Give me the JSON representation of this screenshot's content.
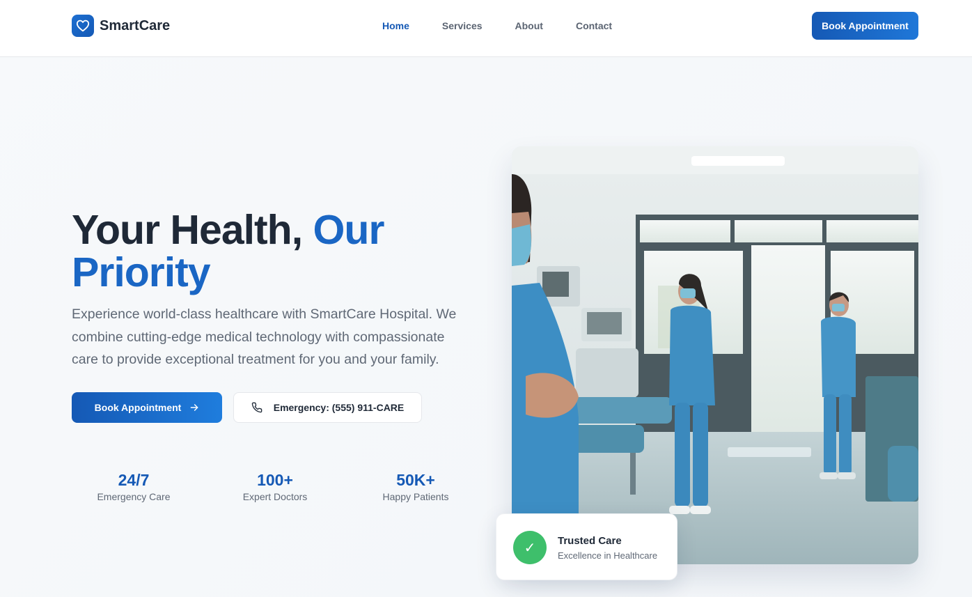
{
  "brand": {
    "name": "SmartCare",
    "logo_icon": "heart-icon"
  },
  "nav": {
    "items": [
      {
        "label": "Home",
        "active": true
      },
      {
        "label": "Services",
        "active": false
      },
      {
        "label": "About",
        "active": false
      },
      {
        "label": "Contact",
        "active": false
      }
    ],
    "cta_label": "Book Appointment"
  },
  "hero": {
    "title_part1": "Your Health,",
    "title_accent": "Our Priority",
    "description": "Experience world-class healthcare with SmartCare Hospital. We combine cutting-edge medical technology with compassionate care to provide exceptional treatment for you and your family.",
    "primary_button": "Book Appointment",
    "secondary_button": "Emergency: (555) 911-CARE"
  },
  "stats": [
    {
      "value": "24/7",
      "label": "Emergency Care"
    },
    {
      "value": "100+",
      "label": "Expert Doctors"
    },
    {
      "value": "50K+",
      "label": "Happy Patients"
    }
  ],
  "trust_card": {
    "title": "Trusted Care",
    "subtitle": "Excellence in Healthcare",
    "icon": "check-icon"
  },
  "colors": {
    "primary": "#1559b5",
    "accent": "#1a66c4",
    "success": "#3ebf6b"
  }
}
